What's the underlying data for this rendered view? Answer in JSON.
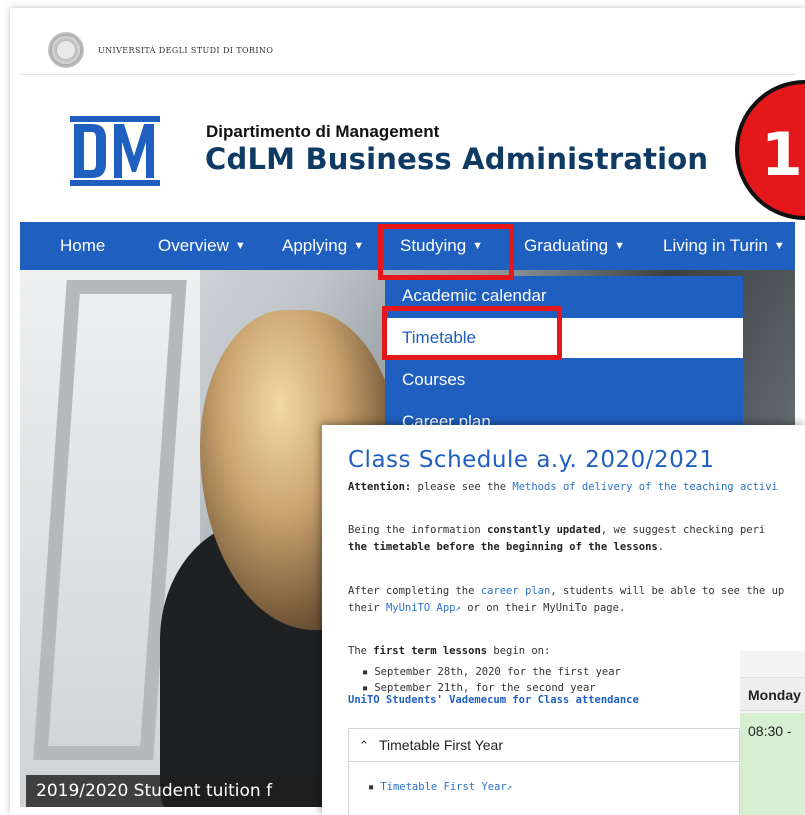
{
  "university": {
    "name": "UNIVERSITÀ DEGLI STUDI DI TORINO"
  },
  "department": {
    "logo_text": "DM",
    "name": "Dipartimento di Management",
    "course": "CdLM Business Administration"
  },
  "badge": {
    "number": "1",
    "color": "#e4171b"
  },
  "nav": {
    "items": [
      {
        "label": "Home",
        "has_caret": false
      },
      {
        "label": "Overview",
        "has_caret": true
      },
      {
        "label": "Applying",
        "has_caret": true
      },
      {
        "label": "Studying",
        "has_caret": true
      },
      {
        "label": "Graduating",
        "has_caret": true
      },
      {
        "label": "Living in Turin",
        "has_caret": true
      }
    ],
    "color": "#1f5fc0"
  },
  "dropdown": {
    "items": [
      "Academic calendar",
      "Timetable",
      "Courses",
      "Career plan"
    ],
    "active": "Timetable"
  },
  "hero": {
    "caption": "2019/2020 Student tuition f"
  },
  "highlight_color": "#e4171b",
  "schedule": {
    "title": "Class Schedule a.y. 2020/2021",
    "attention_label": "Attention:",
    "attention_text": " please see the ",
    "attention_link": "Methods of delivery of the teaching activi",
    "updated_1a": "Being the information ",
    "updated_1b": "constantly updated",
    "updated_1c": ", we suggest checking peri",
    "updated_2": "the timetable before the beginning of the lessons",
    "updated_2_end": ".",
    "after_1a": "After completing the ",
    "after_1_link": "career plan",
    "after_1b": ", students will be able to see the up",
    "after_2a": "their ",
    "after_2_link": "MyUniTO App",
    "after_2b": " or on their MyUniTo page.",
    "first_term_a": "The ",
    "first_term_b": "first term lessons",
    "first_term_c": " begin on:",
    "dates": [
      "September 28th, 2020 for the first year",
      "September 21th, for the second year"
    ],
    "vademecum": "UniTO Students' Vademecum for Class attendance",
    "calendar_day": "Monday",
    "calendar_time": "08:30 -",
    "accordion_label": "Timetable First Year",
    "accordion_link": "Timetable First Year"
  }
}
